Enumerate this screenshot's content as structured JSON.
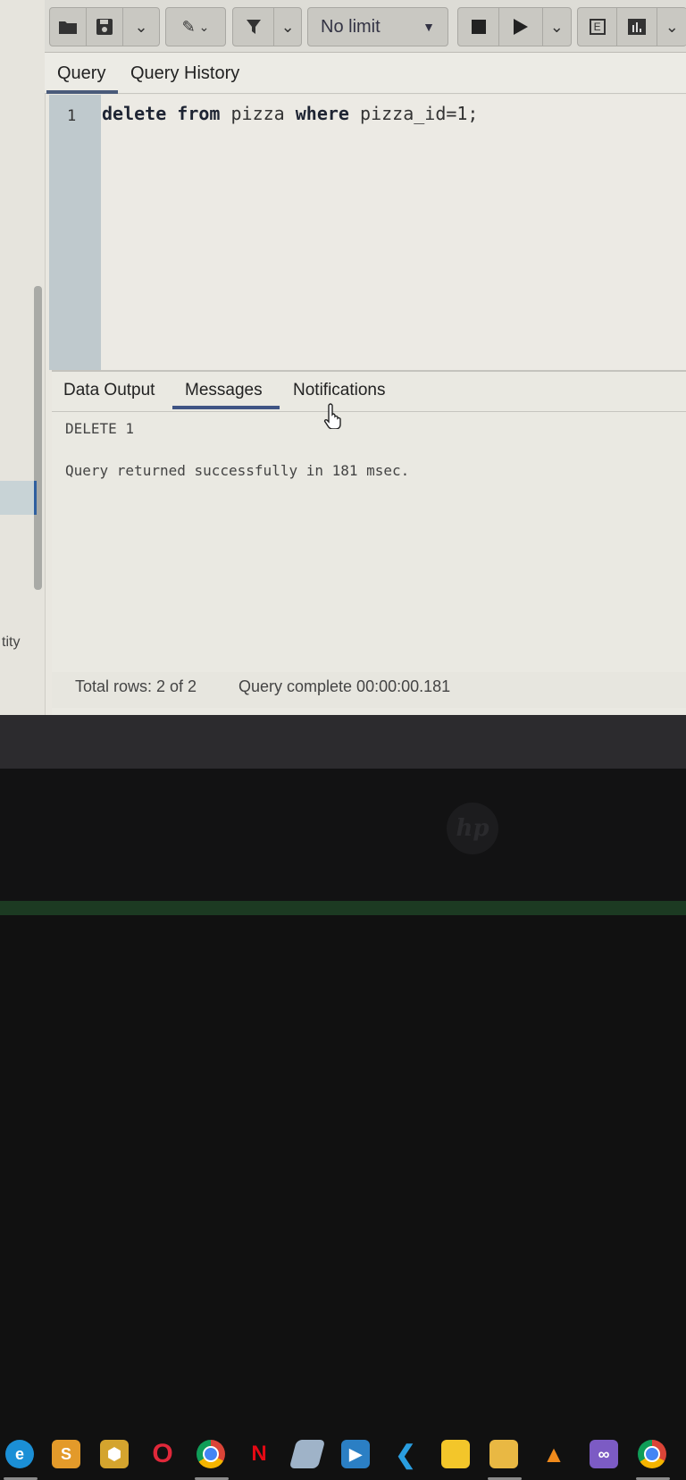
{
  "toolbar": {
    "limit_label": "No limit",
    "explain_label": "E"
  },
  "query_tabs": [
    "Query",
    "Query History"
  ],
  "editor": {
    "line_number": "1",
    "code_parts": [
      "delete",
      " ",
      "from",
      " pizza ",
      "where",
      " pizza_id=1;"
    ]
  },
  "result_tabs": [
    "Data Output",
    "Messages",
    "Notifications"
  ],
  "messages": {
    "line1": "DELETE 1",
    "line2": "Query returned successfully in 181 msec."
  },
  "status": {
    "rows": "Total rows: 2 of 2",
    "complete": "Query complete 00:00:00.181"
  },
  "left_panel": {
    "partial_text": "tity"
  },
  "laptop": {
    "brand": "hp"
  },
  "taskbar_icons": [
    "edge-icon",
    "sublime-icon",
    "box-icon",
    "opera-icon",
    "chrome-icon",
    "netflix-icon",
    "eraser-icon",
    "media-icon",
    "vscode-icon",
    "sticky-notes-icon",
    "file-explorer-icon",
    "vlc-icon",
    "visual-studio-icon",
    "chrome-profile-icon"
  ],
  "colors": {
    "accent": "#3f5484",
    "gutter": "#bfc9cd"
  }
}
